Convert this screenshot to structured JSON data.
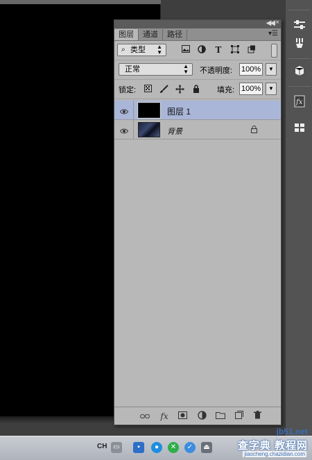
{
  "panel": {
    "tabs": [
      {
        "label": "图层"
      },
      {
        "label": "通道"
      },
      {
        "label": "路径"
      }
    ],
    "filter": {
      "kind_label": "类型"
    },
    "blend_mode": "正常",
    "opacity_label": "不透明度:",
    "opacity_value": "100%",
    "lock_label": "锁定:",
    "fill_label": "填充:",
    "fill_value": "100%",
    "layers": [
      {
        "name": "图层 1",
        "selected": true,
        "visible": true,
        "locked": false
      },
      {
        "name": "背景",
        "selected": false,
        "visible": true,
        "locked": true
      }
    ]
  },
  "taskbar": {
    "lang": "CH",
    "watermark_main": "查字典 教程网",
    "watermark_sub": "jiaocheng.chazidian.com",
    "watermark_site": "jb51.net"
  },
  "colors": {
    "selected_layer": "#a9b6d8",
    "panel_bg": "#b8b8b8",
    "workspace": "#3e3e3e"
  }
}
